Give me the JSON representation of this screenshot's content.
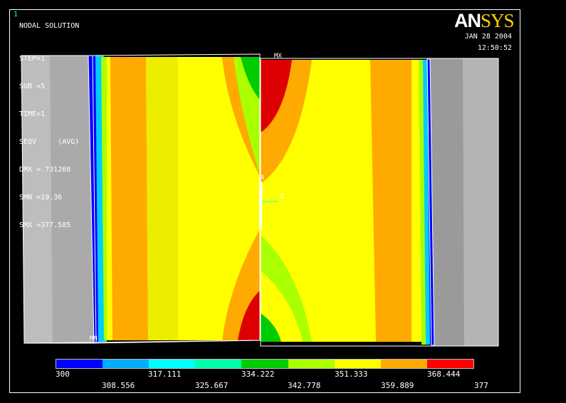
{
  "window_number": "1",
  "logo": {
    "part1": "AN",
    "part2": "SYS"
  },
  "solution_type": "NODAL SOLUTION",
  "info_lines": [
    "STEP=1",
    "SUB =5",
    "TIME=1",
    "SEQV     (AVG)",
    "DMX =.731268",
    "SMN =19.36",
    "SMX =377.585"
  ],
  "date": "JAN 28 2004",
  "time": "12:50:52",
  "markers": {
    "mx": "MX",
    "mn": "MN",
    "x_axis": "X",
    "z_axis": "Z"
  },
  "legend": {
    "colors": [
      "#0000ff",
      "#00aaff",
      "#00ffff",
      "#00ffaa",
      "#00cc00",
      "#aaff00",
      "#ffff00",
      "#ffaa00",
      "#ff0000"
    ],
    "top_labels": [
      "300",
      "317.111",
      "334.222",
      "351.333",
      "368.444"
    ],
    "bottom_labels": [
      "308.556",
      "325.667",
      "342.778",
      "359.889",
      "377"
    ]
  }
}
